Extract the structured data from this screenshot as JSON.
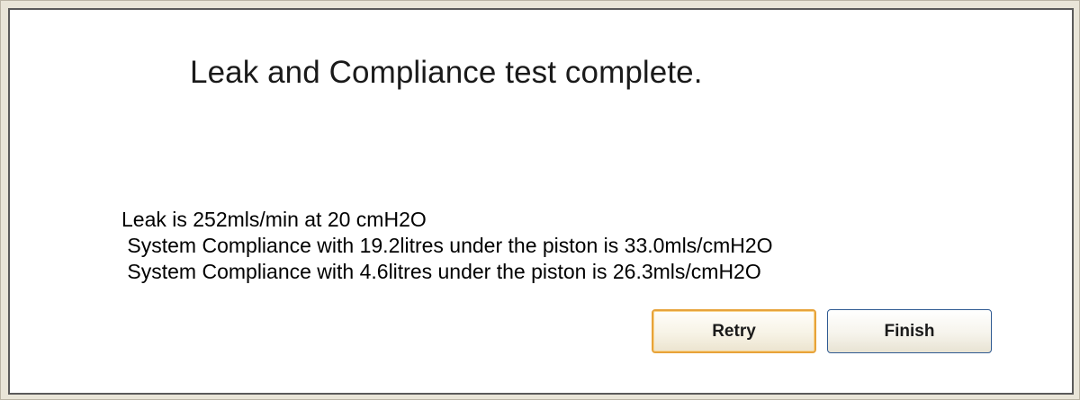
{
  "dialog": {
    "heading": "Leak and Compliance test complete.",
    "results": [
      "Leak is 252mls/min at 20 cmH2O",
      " System Compliance with 19.2litres under the piston is 33.0mls/cmH2O",
      " System Compliance with 4.6litres under the piston is 26.3mls/cmH2O"
    ],
    "buttons": {
      "retry": "Retry",
      "finish": "Finish"
    }
  },
  "colors": {
    "window_background": "#e9e5d8",
    "panel_background": "#ffffff",
    "panel_border": "#5a5a5a",
    "retry_focus_border": "#e7a33a",
    "finish_border": "#2f5a92"
  }
}
